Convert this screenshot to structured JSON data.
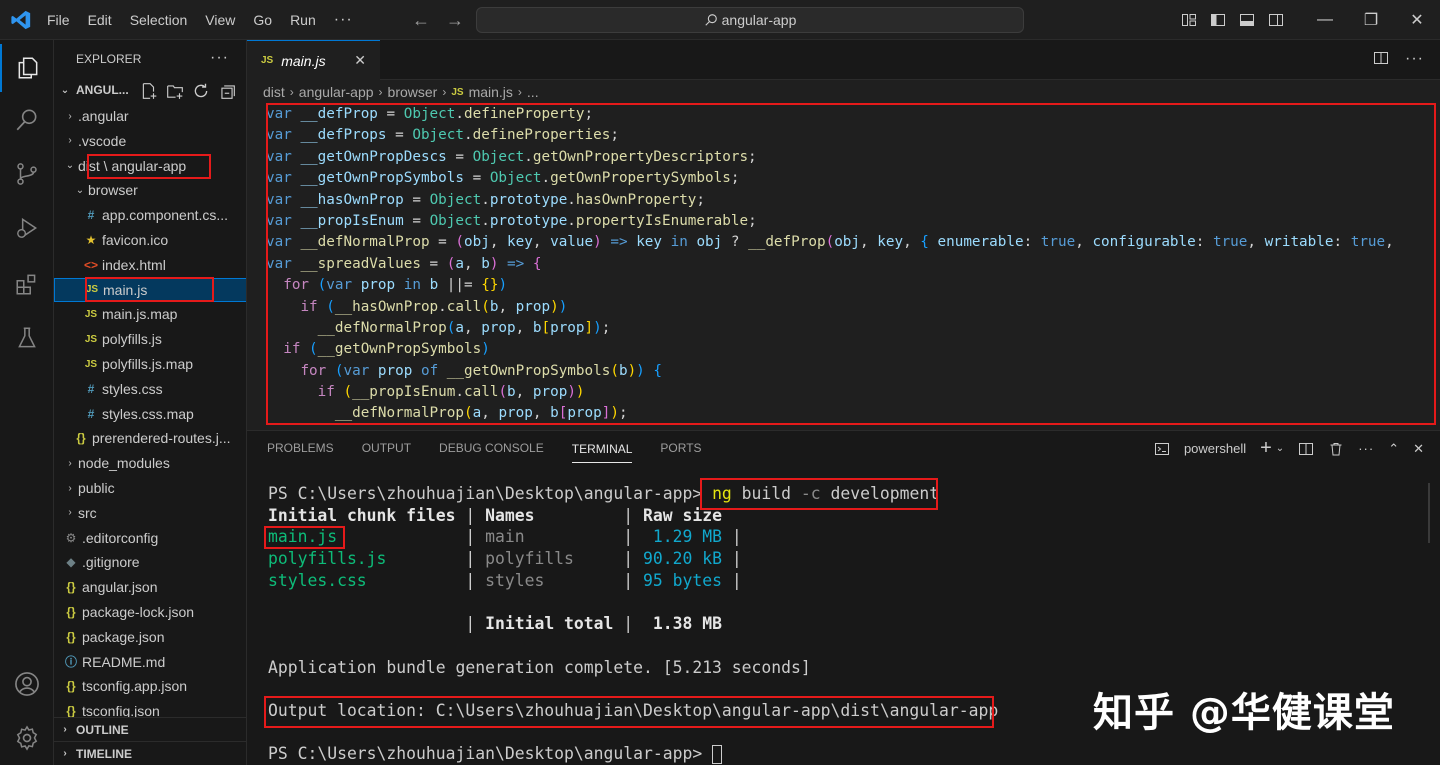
{
  "titlebar": {
    "menu": [
      "File",
      "Edit",
      "Selection",
      "View",
      "Go",
      "Run"
    ],
    "more": "···",
    "search_text": "angular-app"
  },
  "explorer": {
    "title": "EXPLORER",
    "more": "···",
    "root": "ANGUL...",
    "items": [
      {
        "label": ".angular",
        "kind": "folder",
        "depth": 0,
        "expanded": false
      },
      {
        "label": ".vscode",
        "kind": "folder",
        "depth": 0,
        "expanded": false
      },
      {
        "label": "dist \\ angular-app",
        "kind": "folder",
        "depth": 0,
        "expanded": true
      },
      {
        "label": "browser",
        "kind": "folder",
        "depth": 1,
        "expanded": true
      },
      {
        "label": "app.component.cs...",
        "kind": "css",
        "depth": 2
      },
      {
        "label": "favicon.ico",
        "kind": "ico",
        "depth": 2
      },
      {
        "label": "index.html",
        "kind": "html",
        "depth": 2
      },
      {
        "label": "main.js",
        "kind": "js",
        "depth": 2,
        "selected": true
      },
      {
        "label": "main.js.map",
        "kind": "js",
        "depth": 2
      },
      {
        "label": "polyfills.js",
        "kind": "js",
        "depth": 2
      },
      {
        "label": "polyfills.js.map",
        "kind": "js",
        "depth": 2
      },
      {
        "label": "styles.css",
        "kind": "css",
        "depth": 2
      },
      {
        "label": "styles.css.map",
        "kind": "css",
        "depth": 2
      },
      {
        "label": "prerendered-routes.j...",
        "kind": "json",
        "depth": 1
      },
      {
        "label": "node_modules",
        "kind": "folder",
        "depth": 0,
        "expanded": false
      },
      {
        "label": "public",
        "kind": "folder",
        "depth": 0,
        "expanded": false
      },
      {
        "label": "src",
        "kind": "folder",
        "depth": 0,
        "expanded": false
      },
      {
        "label": ".editorconfig",
        "kind": "gear",
        "depth": 0
      },
      {
        "label": ".gitignore",
        "kind": "git",
        "depth": 0
      },
      {
        "label": "angular.json",
        "kind": "json",
        "depth": 0
      },
      {
        "label": "package-lock.json",
        "kind": "json",
        "depth": 0
      },
      {
        "label": "package.json",
        "kind": "json",
        "depth": 0
      },
      {
        "label": "README.md",
        "kind": "info",
        "depth": 0
      },
      {
        "label": "tsconfig.app.json",
        "kind": "json",
        "depth": 0
      },
      {
        "label": "tsconfig.json",
        "kind": "json",
        "depth": 0
      }
    ],
    "outline": "OUTLINE",
    "timeline": "TIMELINE"
  },
  "editor": {
    "tab_icon": "JS",
    "tab_label": "main.js",
    "breadcrumb": [
      "dist",
      "angular-app",
      "browser",
      "main.js",
      "..."
    ],
    "code": [
      [
        [
          "kw",
          "var "
        ],
        [
          "vr",
          "__defProp"
        ],
        [
          "pu",
          " = "
        ],
        [
          "ob",
          "Object"
        ],
        [
          "pu",
          "."
        ],
        [
          "fn",
          "defineProperty"
        ],
        [
          "pu",
          ";"
        ]
      ],
      [
        [
          "kw",
          "var "
        ],
        [
          "vr",
          "__defProps"
        ],
        [
          "pu",
          " = "
        ],
        [
          "ob",
          "Object"
        ],
        [
          "pu",
          "."
        ],
        [
          "fn",
          "defineProperties"
        ],
        [
          "pu",
          ";"
        ]
      ],
      [
        [
          "kw",
          "var "
        ],
        [
          "vr",
          "__getOwnPropDescs"
        ],
        [
          "pu",
          " = "
        ],
        [
          "ob",
          "Object"
        ],
        [
          "pu",
          "."
        ],
        [
          "fn",
          "getOwnPropertyDescriptors"
        ],
        [
          "pu",
          ";"
        ]
      ],
      [
        [
          "kw",
          "var "
        ],
        [
          "vr",
          "__getOwnPropSymbols"
        ],
        [
          "pu",
          " = "
        ],
        [
          "ob",
          "Object"
        ],
        [
          "pu",
          "."
        ],
        [
          "fn",
          "getOwnPropertySymbols"
        ],
        [
          "pu",
          ";"
        ]
      ],
      [
        [
          "kw",
          "var "
        ],
        [
          "vr",
          "__hasOwnProp"
        ],
        [
          "pu",
          " = "
        ],
        [
          "ob",
          "Object"
        ],
        [
          "pu",
          "."
        ],
        [
          "vr",
          "prototype"
        ],
        [
          "pu",
          "."
        ],
        [
          "fn",
          "hasOwnProperty"
        ],
        [
          "pu",
          ";"
        ]
      ],
      [
        [
          "kw",
          "var "
        ],
        [
          "vr",
          "__propIsEnum"
        ],
        [
          "pu",
          " = "
        ],
        [
          "ob",
          "Object"
        ],
        [
          "pu",
          "."
        ],
        [
          "vr",
          "prototype"
        ],
        [
          "pu",
          "."
        ],
        [
          "fn",
          "propertyIsEnumerable"
        ],
        [
          "pu",
          ";"
        ]
      ],
      [
        [
          "kw",
          "var "
        ],
        [
          "fn",
          "__defNormalProp"
        ],
        [
          "pu",
          " = "
        ],
        [
          "br1",
          "("
        ],
        [
          "vr",
          "obj"
        ],
        [
          "pu",
          ", "
        ],
        [
          "vr",
          "key"
        ],
        [
          "pu",
          ", "
        ],
        [
          "vr",
          "value"
        ],
        [
          "br1",
          ")"
        ],
        [
          "pu",
          " "
        ],
        [
          "kw",
          "=>"
        ],
        [
          "pu",
          " "
        ],
        [
          "vr",
          "key"
        ],
        [
          "pu",
          " "
        ],
        [
          "kw",
          "in"
        ],
        [
          "pu",
          " "
        ],
        [
          "vr",
          "obj"
        ],
        [
          "pu",
          " ? "
        ],
        [
          "fn",
          "__defProp"
        ],
        [
          "br1",
          "("
        ],
        [
          "vr",
          "obj"
        ],
        [
          "pu",
          ", "
        ],
        [
          "vr",
          "key"
        ],
        [
          "pu",
          ", "
        ],
        [
          "br2",
          "{"
        ],
        [
          "pu",
          " "
        ],
        [
          "vr",
          "enumerable"
        ],
        [
          "pu",
          ": "
        ],
        [
          "kw",
          "true"
        ],
        [
          "pu",
          ", "
        ],
        [
          "vr",
          "configurable"
        ],
        [
          "pu",
          ": "
        ],
        [
          "kw",
          "true"
        ],
        [
          "pu",
          ", "
        ],
        [
          "vr",
          "writable"
        ],
        [
          "pu",
          ": "
        ],
        [
          "kw",
          "true"
        ],
        [
          "pu",
          ","
        ]
      ],
      [
        [
          "kw",
          "var "
        ],
        [
          "fn",
          "__spreadValues"
        ],
        [
          "pu",
          " = "
        ],
        [
          "br1",
          "("
        ],
        [
          "vr",
          "a"
        ],
        [
          "pu",
          ", "
        ],
        [
          "vr",
          "b"
        ],
        [
          "br1",
          ")"
        ],
        [
          "pu",
          " "
        ],
        [
          "kw",
          "=>"
        ],
        [
          "pu",
          " "
        ],
        [
          "br1",
          "{"
        ]
      ],
      [
        [
          "pu",
          "  "
        ],
        [
          "kc",
          "for"
        ],
        [
          "pu",
          " "
        ],
        [
          "br2",
          "("
        ],
        [
          "kw",
          "var"
        ],
        [
          "pu",
          " "
        ],
        [
          "vr",
          "prop"
        ],
        [
          "pu",
          " "
        ],
        [
          "kw",
          "in"
        ],
        [
          "pu",
          " "
        ],
        [
          "vr",
          "b"
        ],
        [
          "pu",
          " ||= "
        ],
        [
          "br3",
          "{}"
        ],
        [
          "br2",
          ")"
        ]
      ],
      [
        [
          "pu",
          "    "
        ],
        [
          "kc",
          "if"
        ],
        [
          "pu",
          " "
        ],
        [
          "br2",
          "("
        ],
        [
          "fn",
          "__hasOwnProp"
        ],
        [
          "pu",
          "."
        ],
        [
          "fn",
          "call"
        ],
        [
          "br3",
          "("
        ],
        [
          "vr",
          "b"
        ],
        [
          "pu",
          ", "
        ],
        [
          "vr",
          "prop"
        ],
        [
          "br3",
          ")"
        ],
        [
          "br2",
          ")"
        ]
      ],
      [
        [
          "pu",
          "      "
        ],
        [
          "fn",
          "__defNormalProp"
        ],
        [
          "br2",
          "("
        ],
        [
          "vr",
          "a"
        ],
        [
          "pu",
          ", "
        ],
        [
          "vr",
          "prop"
        ],
        [
          "pu",
          ", "
        ],
        [
          "vr",
          "b"
        ],
        [
          "br3",
          "["
        ],
        [
          "vr",
          "prop"
        ],
        [
          "br3",
          "]"
        ],
        [
          "br2",
          ")"
        ],
        [
          "pu",
          ";"
        ]
      ],
      [
        [
          "pu",
          "  "
        ],
        [
          "kc",
          "if"
        ],
        [
          "pu",
          " "
        ],
        [
          "br2",
          "("
        ],
        [
          "fn",
          "__getOwnPropSymbols"
        ],
        [
          "br2",
          ")"
        ]
      ],
      [
        [
          "pu",
          "    "
        ],
        [
          "kc",
          "for"
        ],
        [
          "pu",
          " "
        ],
        [
          "br2",
          "("
        ],
        [
          "kw",
          "var"
        ],
        [
          "pu",
          " "
        ],
        [
          "vr",
          "prop"
        ],
        [
          "pu",
          " "
        ],
        [
          "kw",
          "of"
        ],
        [
          "pu",
          " "
        ],
        [
          "fn",
          "__getOwnPropSymbols"
        ],
        [
          "br3",
          "("
        ],
        [
          "vr",
          "b"
        ],
        [
          "br3",
          ")"
        ],
        [
          "br2",
          ")"
        ],
        [
          "pu",
          " "
        ],
        [
          "br2",
          "{"
        ]
      ],
      [
        [
          "pu",
          "      "
        ],
        [
          "kc",
          "if"
        ],
        [
          "pu",
          " "
        ],
        [
          "br3",
          "("
        ],
        [
          "fn",
          "__propIsEnum"
        ],
        [
          "pu",
          "."
        ],
        [
          "fn",
          "call"
        ],
        [
          "br1",
          "("
        ],
        [
          "vr",
          "b"
        ],
        [
          "pu",
          ", "
        ],
        [
          "vr",
          "prop"
        ],
        [
          "br1",
          ")"
        ],
        [
          "br3",
          ")"
        ]
      ],
      [
        [
          "pu",
          "        "
        ],
        [
          "fn",
          "__defNormalProp"
        ],
        [
          "br3",
          "("
        ],
        [
          "vr",
          "a"
        ],
        [
          "pu",
          ", "
        ],
        [
          "vr",
          "prop"
        ],
        [
          "pu",
          ", "
        ],
        [
          "vr",
          "b"
        ],
        [
          "br1",
          "["
        ],
        [
          "vr",
          "prop"
        ],
        [
          "br1",
          "]"
        ],
        [
          "br3",
          ")"
        ],
        [
          "pu",
          ";"
        ]
      ]
    ]
  },
  "panel": {
    "tabs": [
      "PROBLEMS",
      "OUTPUT",
      "DEBUG CONSOLE",
      "TERMINAL",
      "PORTS"
    ],
    "active_tab": "TERMINAL",
    "shell": "powershell",
    "terminal": [
      [
        [
          "n",
          "PS C:\\Users\\zhouhuajian\\Desktop\\angular-app> "
        ],
        [
          "y",
          "ng"
        ],
        [
          "n",
          " build "
        ],
        [
          "gr",
          "-c"
        ],
        [
          "n",
          " development"
        ]
      ],
      [
        [
          "b",
          "Initial chunk files"
        ],
        [
          "n",
          " | "
        ],
        [
          "b",
          "Names"
        ],
        [
          "n",
          "         | "
        ],
        [
          "b",
          "Raw size"
        ]
      ],
      [
        [
          "g",
          "main.js"
        ],
        [
          "n",
          "             | "
        ],
        [
          "gr",
          "main"
        ],
        [
          "n",
          "          | "
        ],
        [
          "c",
          " 1.29 MB"
        ],
        [
          "n",
          " |"
        ]
      ],
      [
        [
          "g",
          "polyfills.js"
        ],
        [
          "n",
          "        | "
        ],
        [
          "gr",
          "polyfills"
        ],
        [
          "n",
          "     | "
        ],
        [
          "c",
          "90.20 kB"
        ],
        [
          "n",
          " |"
        ]
      ],
      [
        [
          "g",
          "styles.css"
        ],
        [
          "n",
          "          | "
        ],
        [
          "gr",
          "styles"
        ],
        [
          "n",
          "        | "
        ],
        [
          "c",
          "95 bytes"
        ],
        [
          "n",
          " |"
        ]
      ],
      [
        [
          "n",
          " "
        ]
      ],
      [
        [
          "n",
          "                    | "
        ],
        [
          "b",
          "Initial total"
        ],
        [
          "n",
          " | "
        ],
        [
          "b",
          " 1.38 MB"
        ]
      ],
      [
        [
          "n",
          " "
        ]
      ],
      [
        [
          "n",
          "Application bundle generation complete. [5.213 seconds]"
        ]
      ],
      [
        [
          "n",
          " "
        ]
      ],
      [
        [
          "n",
          "Output location: C:\\Users\\zhouhuajian\\Desktop\\angular-app\\dist\\angular-app"
        ]
      ],
      [
        [
          "n",
          " "
        ]
      ],
      [
        [
          "n",
          "PS C:\\Users\\zhouhuajian\\Desktop\\angular-app> "
        ],
        [
          "cur",
          ""
        ]
      ]
    ]
  },
  "watermark": "知乎 @华健课堂"
}
